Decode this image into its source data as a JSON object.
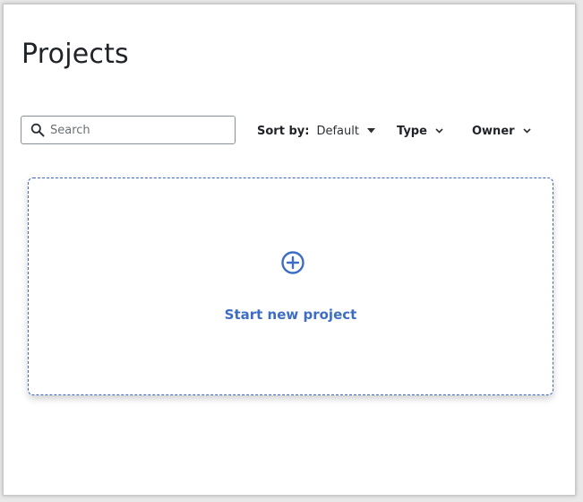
{
  "header": {
    "title": "Projects"
  },
  "search": {
    "placeholder": "Search",
    "value": ""
  },
  "filters": {
    "sort_label": "Sort by:",
    "sort_value": "Default",
    "type_label": "Type",
    "owner_label": "Owner"
  },
  "new_project": {
    "label": "Start new project",
    "icon": "plus-circle-icon"
  },
  "colors": {
    "accent": "#3e6ec4",
    "text": "#1f2328",
    "border": "#8a9099"
  }
}
